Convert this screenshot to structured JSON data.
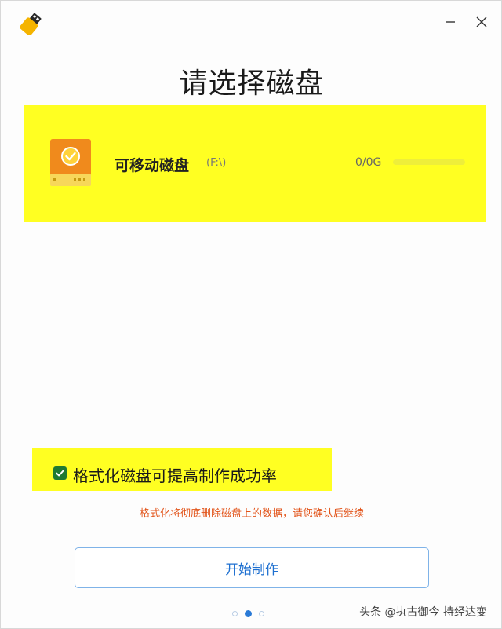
{
  "window": {
    "title": "请选择磁盘",
    "icons": {
      "app": "usb-drive-icon",
      "minimize": "minimize-icon",
      "close": "close-icon"
    }
  },
  "disks": [
    {
      "name": "可移动磁盘",
      "path": "(F:\\)",
      "size": "0/0G",
      "usage_fraction": 0,
      "selected": true,
      "icon": "removable-disk-icon"
    }
  ],
  "format_option": {
    "label": "格式化磁盘可提高制作成功率",
    "checked": true
  },
  "warning": "格式化将彻底删除磁盘上的数据，请您确认后继续",
  "start_button": {
    "label": "开始制作"
  },
  "pager": {
    "count": 3,
    "active": 1
  },
  "watermark": "头条 @执古御今 持经达变",
  "colors": {
    "highlight": "#ffff22",
    "accent_blue": "#1d6fd0",
    "warning_orange": "#e2541a",
    "checkbox_green": "#1f7a32",
    "disk_orange": "#f08a1c"
  }
}
